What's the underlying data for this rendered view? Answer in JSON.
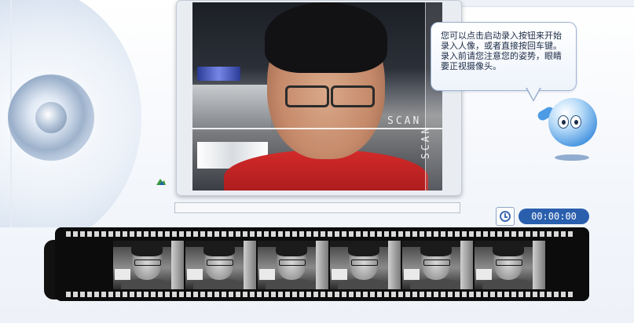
{
  "instruction_bubble": {
    "text": "您可以点击启动录入按钮来开始录入人像，或者直接按回车键。录入前请您注意您的姿势，眼睛要正视摄像头。"
  },
  "video": {
    "scan_label_horizontal": "SCAN",
    "scan_label_vertical": "SCAN"
  },
  "progress": {
    "value": 0
  },
  "timer": {
    "value": "00:00:00"
  },
  "film_strip": {
    "frame_count": 6
  },
  "icons": {
    "timer": "clock-icon",
    "mascot": "mascot-character",
    "small": "green-mountain-icon"
  },
  "colors": {
    "accent": "#2a5fae",
    "shirt": "#d42a2a",
    "bubble_border": "#9eb3d2"
  }
}
